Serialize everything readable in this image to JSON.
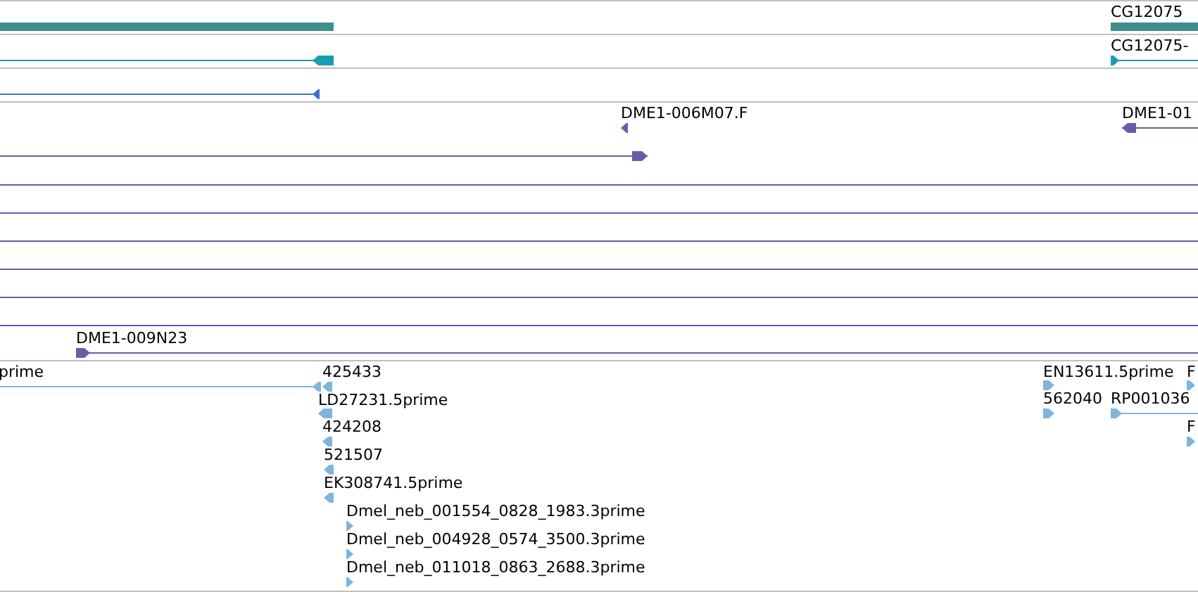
{
  "tracks": [
    {
      "kind": "gene",
      "features": [
        {
          "kind": "bar"
        },
        {
          "kind": "bar",
          "label": "CG12075"
        }
      ]
    },
    {
      "kind": "transcript",
      "features": [
        {
          "kind": "arrow",
          "reverse": true
        },
        {
          "kind": "arrow",
          "reverse": false,
          "label": "CG12075-"
        }
      ]
    },
    {
      "kind": "match",
      "features": [
        {
          "kind": "arrow",
          "reverse": true
        }
      ]
    },
    {
      "kind": "clone",
      "features": [
        {
          "kind": "marker",
          "reverse": true,
          "label": "DME1-006M07.F"
        },
        {
          "kind": "arrow",
          "reverse": false
        },
        {
          "kind": "arrow",
          "reverse": true,
          "label": "DME1-01"
        },
        {
          "kind": "line"
        },
        {
          "kind": "line"
        },
        {
          "kind": "line"
        },
        {
          "kind": "line"
        },
        {
          "kind": "line"
        },
        {
          "kind": "line"
        },
        {
          "kind": "arrow",
          "reverse": false,
          "label": "DME1-009N23"
        }
      ]
    },
    {
      "kind": "est",
      "features": [
        {
          "kind": "arrow",
          "reverse": true,
          "label": "prime"
        },
        {
          "kind": "marker",
          "reverse": true,
          "label": "425433"
        },
        {
          "kind": "marker",
          "reverse": true,
          "label": "LD27231.5prime"
        },
        {
          "kind": "marker",
          "reverse": true,
          "label": "424208"
        },
        {
          "kind": "marker",
          "reverse": true,
          "label": "521507"
        },
        {
          "kind": "marker",
          "reverse": true,
          "label": "EK308741.5prime"
        },
        {
          "kind": "marker",
          "reverse": false,
          "label": "Dmel_neb_001554_0828_1983.3prime"
        },
        {
          "kind": "marker",
          "reverse": false,
          "label": "Dmel_neb_004928_0574_3500.3prime"
        },
        {
          "kind": "marker",
          "reverse": false,
          "label": "Dmel_neb_011018_0863_2688.3prime"
        },
        {
          "kind": "marker",
          "reverse": false,
          "label": "EN13611.5prime"
        },
        {
          "kind": "marker",
          "reverse": false,
          "label": "F"
        },
        {
          "kind": "marker",
          "reverse": false,
          "label": "562040"
        },
        {
          "kind": "arrow",
          "reverse": false,
          "label": "RP001036"
        },
        {
          "kind": "marker",
          "reverse": false,
          "label": "F"
        }
      ]
    }
  ]
}
